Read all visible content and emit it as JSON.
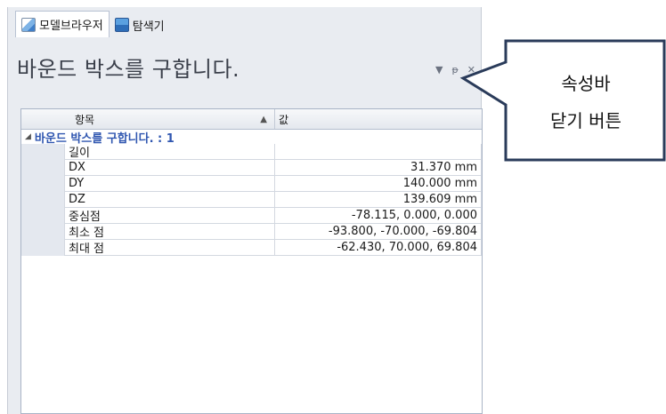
{
  "tabs": [
    {
      "label": "모델브라우저",
      "icon": "model-browser-icon",
      "active": true
    },
    {
      "label": "탐색기",
      "icon": "explorer-icon",
      "active": false
    }
  ],
  "panel": {
    "title": "바운드 박스를 구합니다.",
    "dropdown_glyph": "▼",
    "pin_glyph": "ᵽ",
    "close_glyph": "✕"
  },
  "grid": {
    "headers": {
      "name": "항목",
      "value": "값",
      "sort_glyph": "▲"
    },
    "category": {
      "label": "바운드 박스를 구합니다. : 1",
      "toggle": "◢"
    },
    "rows": [
      {
        "name": "길이",
        "value": ""
      },
      {
        "name": "DX",
        "value": "31.370 mm"
      },
      {
        "name": "DY",
        "value": "140.000 mm"
      },
      {
        "name": "DZ",
        "value": "139.609 mm"
      },
      {
        "name": "중심점",
        "value": "-78.115, 0.000, 0.000"
      },
      {
        "name": "최소 점",
        "value": "-93.800, -70.000, -69.804"
      },
      {
        "name": "최대 점",
        "value": "-62.430, 70.000, 69.804"
      }
    ]
  },
  "callout": {
    "line1": "속성바",
    "line2": "닫기 버튼"
  },
  "colors": {
    "accent": "#2f56b0",
    "callout_border": "#2a3b5a"
  }
}
